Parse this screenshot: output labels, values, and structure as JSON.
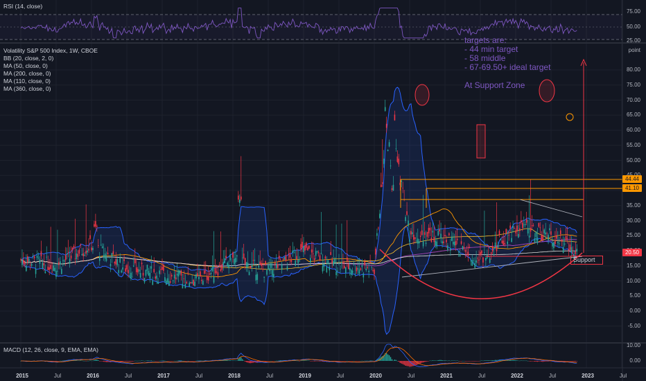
{
  "rsi": {
    "label": "RSI (14, close)",
    "levels": [
      75,
      50,
      25
    ],
    "tick_labels": [
      "75.00",
      "50.00",
      "25.00"
    ]
  },
  "main": {
    "legend": [
      "Volatility S&P 500 Index, 1W, CBOE",
      "BB (20, close, 2, 0)",
      "MA (50, close, 0)",
      "MA (200, close, 0)",
      "MA (110, close, 0)",
      "MA (360, close, 0)"
    ],
    "axis_unit": "point",
    "y_ticks": [
      "80.00",
      "75.00",
      "70.00",
      "65.00",
      "60.00",
      "55.00",
      "50.00",
      "45.00",
      "40.00",
      "35.00",
      "30.00",
      "25.00",
      "20.00",
      "15.00",
      "10.00",
      "5.00",
      "0.00",
      "-5.00"
    ]
  },
  "annotation": {
    "lines": [
      "targets are:",
      "- 44 min target",
      "- 58 middle",
      "- 67-69.50+ ideal target",
      "",
      "At Support Zone"
    ],
    "color": "#7e57c2"
  },
  "price_labels": [
    {
      "text": "44.44",
      "value": 44.44,
      "color": "#ff9800"
    },
    {
      "text": "41.10",
      "value": 41.1,
      "color": "#ff9800"
    },
    {
      "text": "20.50",
      "value": 20.5,
      "color": "#f23645"
    }
  ],
  "support_label": "Support",
  "macd": {
    "label": "MACD (12, 26, close, 9, EMA, EMA)",
    "tick_labels": [
      "10.00",
      "0.00"
    ]
  },
  "x_axis": {
    "labels": [
      {
        "text": "2015",
        "bold": true
      },
      {
        "text": "Jul",
        "bold": false
      },
      {
        "text": "2016",
        "bold": true
      },
      {
        "text": "Jul",
        "bold": false
      },
      {
        "text": "2017",
        "bold": true
      },
      {
        "text": "Jul",
        "bold": false
      },
      {
        "text": "2018",
        "bold": true
      },
      {
        "text": "Jul",
        "bold": false
      },
      {
        "text": "2019",
        "bold": true
      },
      {
        "text": "Jul",
        "bold": false
      },
      {
        "text": "2020",
        "bold": true
      },
      {
        "text": "Jul",
        "bold": false
      },
      {
        "text": "2021",
        "bold": true
      },
      {
        "text": "Jul",
        "bold": false
      },
      {
        "text": "2022",
        "bold": true
      },
      {
        "text": "Jul",
        "bold": false
      },
      {
        "text": "2023",
        "bold": true
      },
      {
        "text": "Jul",
        "bold": false
      }
    ]
  },
  "chart_data": {
    "type": "line",
    "title": "Volatility S&P 500 Index, 1W, CBOE",
    "ylabel": "point",
    "ylim": [
      -7,
      85
    ],
    "x": [
      "2015-01",
      "2015-07",
      "2016-01",
      "2016-07",
      "2017-01",
      "2017-07",
      "2018-01",
      "2018-07",
      "2019-01",
      "2019-07",
      "2020-01",
      "2020-03",
      "2020-07",
      "2021-01",
      "2021-07",
      "2022-01",
      "2022-07",
      "2022-10"
    ],
    "series": [
      {
        "values": [
          17,
          15,
          22,
          14,
          12,
          10,
          17,
          13,
          20,
          15,
          14,
          66,
          26,
          24,
          17,
          28,
          25,
          21
        ]
      }
    ],
    "grid": true,
    "colors": {
      "up": "#26a69a",
      "down": "#f23645",
      "bb": "#2962ff",
      "resistance": "#ff9800",
      "cup": "#f23645"
    }
  }
}
